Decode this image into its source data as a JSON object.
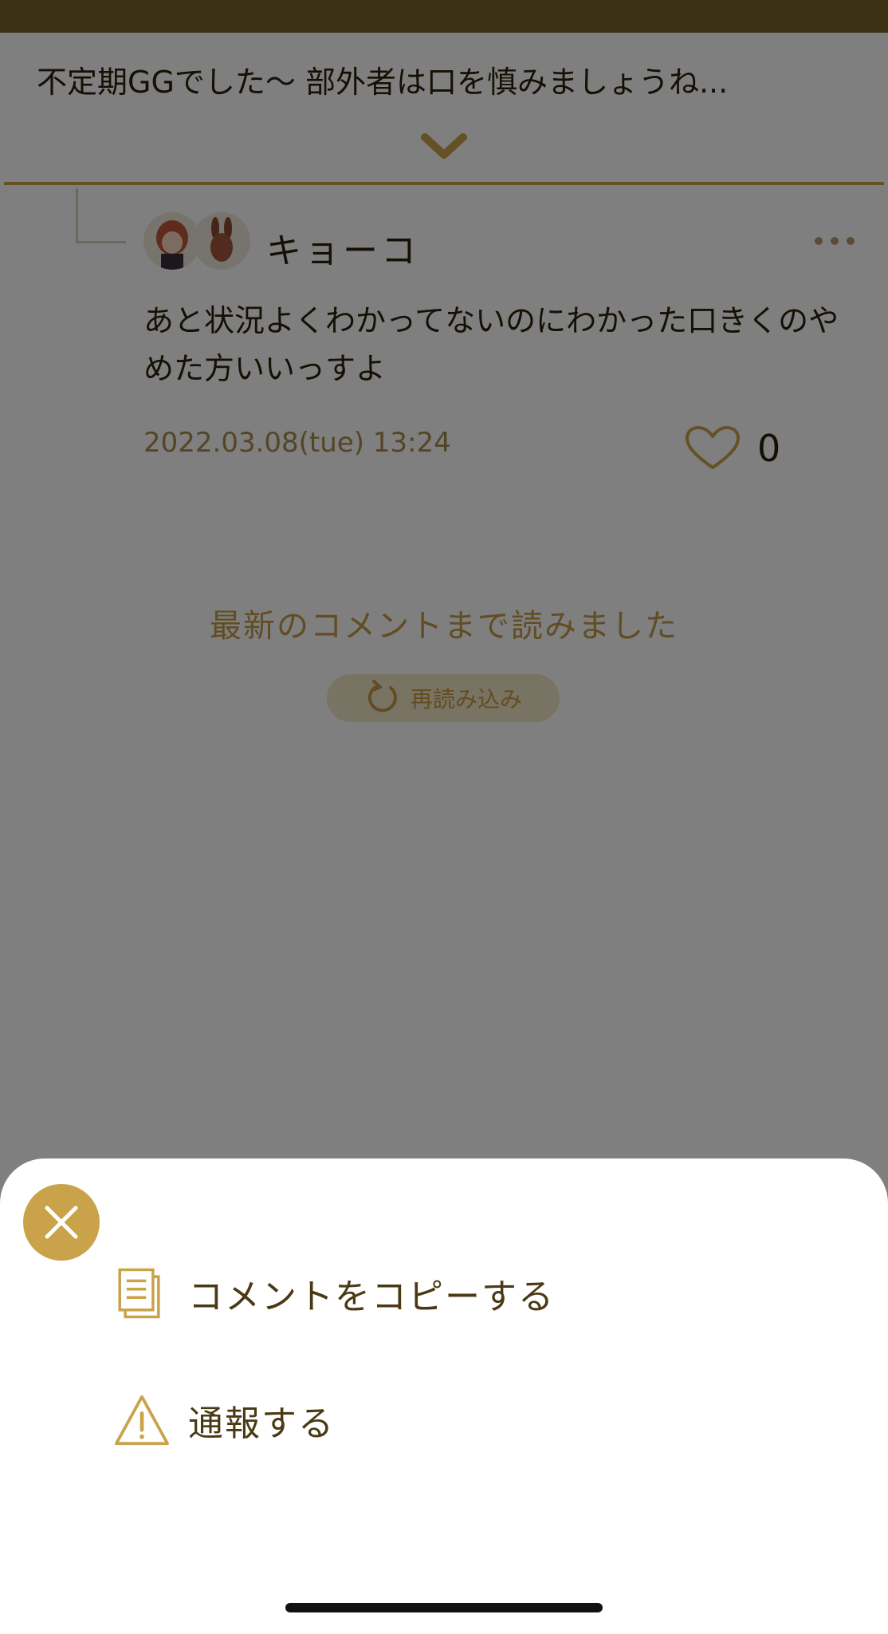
{
  "thread": {
    "title": "不定期GGでした〜 部外者は口を慎みましょうね..."
  },
  "comment": {
    "username": "キョーコ",
    "body": "あと状況よくわかってないのにわかった口きくのやめた方いいっすよ",
    "timestamp": "2022.03.08(tue) 13:24",
    "like_count": "0"
  },
  "feed_end": {
    "message": "最新のコメントまで読みました",
    "reload_label": "再読み込み"
  },
  "action_sheet": {
    "items": [
      {
        "label": "コメントをコピーする",
        "icon": "copy-document-icon"
      },
      {
        "label": "通報する",
        "icon": "warning-triangle-icon"
      }
    ]
  },
  "colors": {
    "accent_gold": "#c9a24a",
    "header_brown": "#7a6229",
    "text_dark": "#2a1f08",
    "overlay": "rgba(0,0,0,0.5)"
  }
}
